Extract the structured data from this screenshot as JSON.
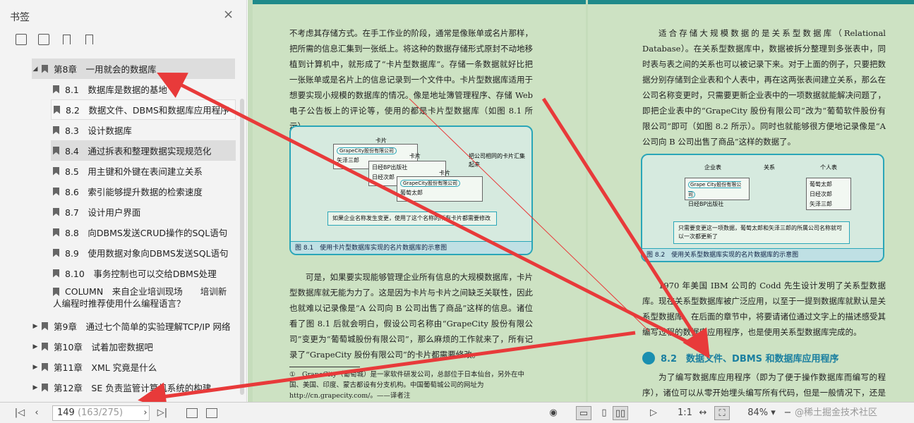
{
  "sidebar": {
    "title": "书签",
    "close": "×",
    "tools": [
      "expand-all-icon",
      "collapse-all-icon",
      "add-bookmark-icon",
      "bookmark-icon"
    ],
    "items": [
      {
        "label": "第8章　一用就会的数据库",
        "arrow": "◢"
      },
      {
        "label": "8.1　数据库是数据的基地"
      },
      {
        "label": "8.2　数据文件、DBMS和数据库应用程序"
      },
      {
        "label": "8.3　设计数据库"
      },
      {
        "label": "8.4　通过拆表和整理数据实现规范化"
      },
      {
        "label": "8.5　用主键和外键在表间建立关系"
      },
      {
        "label": "8.6　索引能够提升数据的检索速度"
      },
      {
        "label": "8.7　设计用户界面"
      },
      {
        "label": "8.8　向DBMS发送CRUD操作的SQL语句"
      },
      {
        "label": "8.9　使用数据对象向DBMS发送SQL语句"
      },
      {
        "label": "8.10　事务控制也可以交给DBMS处理"
      },
      {
        "label": "COLUMN　来自企业培训现场　　培训新",
        "label2": "人编程时推荐使用什么编程语言？"
      },
      {
        "label": "第9章　通过七个简单的实验理解TCP/IP 网络",
        "arrow": "▶"
      },
      {
        "label": "第10章　试着加密数据吧",
        "arrow": "▶"
      },
      {
        "label": "第11章　XML 究竟是什么",
        "arrow": "▶"
      },
      {
        "label": "第12章　SE 负责监管计算机系统的构建",
        "arrow": "▶"
      }
    ]
  },
  "left_page": {
    "para1": "不考虑其存储方式。在手工作业的阶段，通常是像账单或名片那样，把所需的信息汇集到一张纸上。将这种的数据存储形式原封不动地移植到计算机中，就形成了“卡片型数据库”。存储一条数据就好比把一张账单或是名片上的信息记录到一个文件中。卡片型数据库适用于想要实现小规模的数据库的情况。像是地址簿管理程序、存储 Web 电子公告板上的评论等，使用的都是卡片型数据库（如图 8.1 所示）。",
    "fig1": {
      "card_label": "卡片",
      "c1": "GrapeCity股份有限公司",
      "c2": "矢泽三郎",
      "c3": "日经BP出版社",
      "c4": "日经次郎",
      "c5": "GrapeCity股份有限公司",
      "c6": "葡萄太郎",
      "side": "把公司相同的卡片汇集起来",
      "note": "如果企业名称发生变更，使用了这个名称的所有卡片都需要修改",
      "caption": "图 8.1　使用卡片型数据库实现的名片数据库的示意图"
    },
    "para2": "可是，如果要实现能够管理企业所有信息的大规模数据库，卡片型数据库就无能为力了。这是因为卡片与卡片之间缺乏关联性，因此也就难以记录像是“A 公司向 B 公司出售了商品”这样的信息。诸位看了图 8.1 后就会明白，假设公司名称由“GrapeCity 股份有限公司”变更为“葡萄城股份有限公司”，那么麻烦的工作就来了，所有记录了“GrapeCity 股份有限公司”的卡片都需要修改。",
    "footnote": "①　GrapeCity（葡萄城）是一家软件研发公司，总部位于日本仙台，另外在中国、美国、印度、蒙古都设有分支机构。中国葡萄城公司的网址为 http://cn.grapecity.com/。——译者注"
  },
  "right_page": {
    "para1": "适合存储大规模数据的是关系型数据库（Relational Database）。在关系型数据库中，数据被拆分整理到多张表中，同时表与表之间的关系也可以被记录下来。对于上面的例子，只要把数据分别存储到企业表和个人表中，再在这两张表间建立关系，那么在公司名称变更时，只需要更新企业表中的一项数据就能解决问题了，即把企业表中的“GrapeCity 股份有限公司”改为“葡萄软件股份有限公司”即可（如图 8.2 所示）。同时也就能够很方便地记录像是“A 公司向 B 公司出售了商品”这样的数据了。",
    "fig2": {
      "h1": "企业表",
      "h2": "关系",
      "h3": "个人表",
      "e1": "Grape City股份有限公司",
      "e2": "日经BP出版社",
      "p1": "葡萄太郎",
      "p2": "日经次郎",
      "p3": "矢泽三郎",
      "note": "只需要变更这一项数据，葡萄太郎和矢泽三郎的所属公司名称就可以一次都更新了",
      "caption": "图 8.2　使用关系型数据库实现的名片数据库的示意图"
    },
    "para2": "1970 年美国 IBM 公司的 Codd 先生设计发明了关系型数据库。现在关系型数据库被广泛应用，以至于一提到数据库就默认是关系型数据库。在后面的章节中，将要请诸位通过文字上的描述感受其编写过程的数据库应用程序，也是使用关系型数据库完成的。",
    "section": "8.2　数据文件、DBMS 和数据库应用程序",
    "para3": "为了编写数据库应用程序（即为了便于操作数据库而编写的程序），诸位可以从零开始埋头编写所有代码，但是一般情况下，还是会借助"
  },
  "bottom": {
    "page": "149",
    "page_total": "(163/275)",
    "zoom": "84%",
    "watermark": "@稀土掘金技术社区"
  },
  "colors": {
    "accent": "#e83a3a",
    "teal": "#2aa6b8"
  }
}
